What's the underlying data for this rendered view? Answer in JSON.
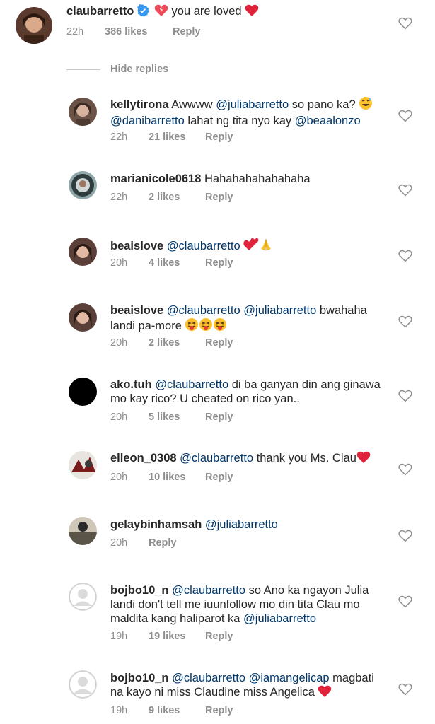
{
  "main_comment": {
    "username": "claubarretto",
    "text": "you are loved",
    "time": "22h",
    "likes": "386 likes",
    "reply": "Reply"
  },
  "hide_replies_label": "Hide replies",
  "replies": [
    {
      "username": "kellytirona",
      "time": "22h",
      "likes": "21 likes",
      "reply": "Reply",
      "parts": [
        "Awwww ",
        "@juliabarretto",
        " so pano ka? ",
        "[grin-sweat-emoji]",
        "@danibarretto",
        " lahat ng tita nyo kay ",
        "@beaalonzo"
      ]
    },
    {
      "username": "marianicole0618",
      "time": "22h",
      "likes": "2 likes",
      "reply": "Reply",
      "parts": [
        "Hahahahahahahaha"
      ]
    },
    {
      "username": "beaislove",
      "time": "20h",
      "likes": "4 likes",
      "reply": "Reply",
      "parts": [
        "@claubarretto",
        " ",
        "[two-hearts-emoji]",
        "[pray-emoji]"
      ]
    },
    {
      "username": "beaislove",
      "time": "20h",
      "likes": "2 likes",
      "reply": "Reply",
      "parts": [
        "@claubarretto",
        " ",
        "@juliabarretto",
        " bwahaha landi pa-more ",
        "[tongue-emoji]",
        "[tongue-emoji]",
        "[tongue-emoji]"
      ]
    },
    {
      "username": "ako.tuh",
      "time": "20h",
      "likes": "5 likes",
      "reply": "Reply",
      "parts": [
        "@claubarretto",
        " di ba ganyan din ang ginawa mo kay rico? U cheated on rico yan.."
      ]
    },
    {
      "username": "elleon_0308",
      "time": "20h",
      "likes": "10 likes",
      "reply": "Reply",
      "parts": [
        "@claubarretto",
        " thank you Ms. Clau",
        "[red-heart-emoji]"
      ]
    },
    {
      "username": "gelaybinhamsah",
      "time": "20h",
      "likes": "",
      "reply": "Reply",
      "parts": [
        "@juliabarretto"
      ]
    },
    {
      "username": "bojbo10_n",
      "time": "19h",
      "likes": "19 likes",
      "reply": "Reply",
      "parts": [
        "@claubarretto",
        " so Ano ka ngayon Julia landi don't tell me iuunfollow mo din tita Clau mo maldita kang haliparot ka ",
        "@juliabarretto"
      ]
    },
    {
      "username": "bojbo10_n",
      "time": "19h",
      "likes": "9 likes",
      "reply": "Reply",
      "parts": [
        "@claubarretto",
        " ",
        "@iamangelicap",
        "  magbati na kayo ni miss Claudine miss Angelica ",
        "[red-heart-emoji]"
      ]
    }
  ],
  "colors": {
    "text": "#262626",
    "muted": "#8e8e8e",
    "mention": "#00376b",
    "verified": "#3897f0",
    "heart_red": "#ed4956"
  }
}
